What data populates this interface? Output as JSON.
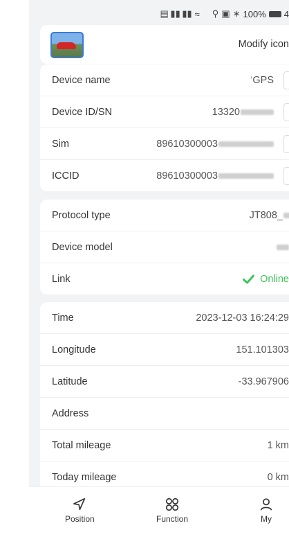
{
  "status_bar": {
    "time_text": "",
    "battery": "100%",
    "trailing": "4"
  },
  "header": {
    "modify_icon_label": "Modify icon"
  },
  "device_info": [
    {
      "label": "Device name",
      "value": "GPS",
      "value_prefix": "‘"
    },
    {
      "label": "Device ID/SN",
      "value": "13320"
    },
    {
      "label": "Sim",
      "value": "89610300003"
    },
    {
      "label": "ICCID",
      "value": "89610300003"
    }
  ],
  "protocol": {
    "protocol_type_label": "Protocol type",
    "protocol_type_value": "JT808_",
    "device_model_label": "Device model",
    "device_model_value": "",
    "link_label": "Link",
    "link_value": "Online"
  },
  "location": [
    {
      "label": "Time",
      "value": "2023-12-03 16:24:29"
    },
    {
      "label": "Longitude",
      "value": "151.101303"
    },
    {
      "label": "Latitude",
      "value": "-33.967906"
    },
    {
      "label": "Address",
      "value": ""
    },
    {
      "label": "Total mileage",
      "value": "1 km"
    },
    {
      "label": "Today mileage",
      "value": "0 km"
    }
  ],
  "tabs": [
    {
      "label": "Position",
      "icon": "navigation-arrow-icon"
    },
    {
      "label": "Function",
      "icon": "grid-icon"
    },
    {
      "label": "My",
      "icon": "person-icon"
    }
  ],
  "colors": {
    "online": "#3ec45a",
    "background": "#f2f3f5"
  }
}
